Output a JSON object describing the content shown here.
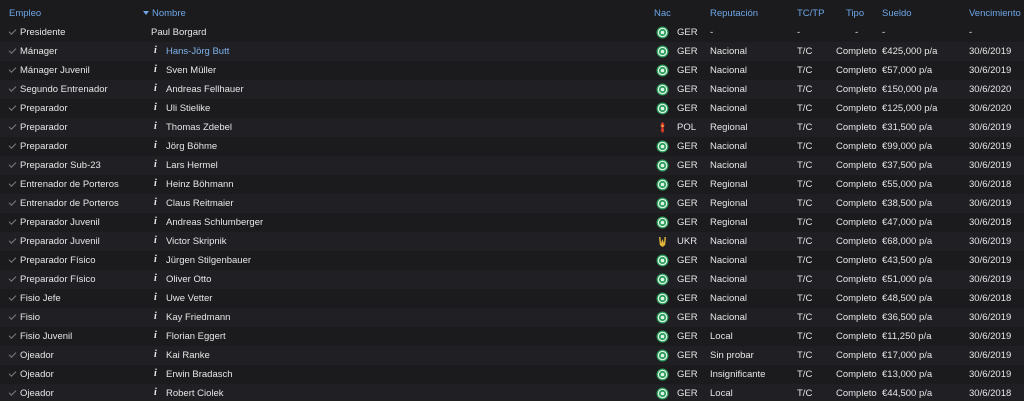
{
  "columns": {
    "empleo": "Empleo",
    "nombre": "Nombre",
    "nac": "Nac",
    "reputacion": "Reputación",
    "tctp": "TC/TP",
    "tipo": "Tipo",
    "sueldo": "Sueldo",
    "vencimiento": "Vencimiento"
  },
  "rows": [
    {
      "empleo": "Presidente",
      "nombre": "Paul Borgard",
      "info": "",
      "nac": "GER",
      "flag": "ger",
      "reputacion": "-",
      "tctp": "-",
      "tipo": "-",
      "sueldo": "-",
      "vencimiento": "-"
    },
    {
      "empleo": "Mánager",
      "nombre": "Hans-Jörg Butt",
      "info": "i",
      "nac": "GER",
      "flag": "ger",
      "reputacion": "Nacional",
      "tctp": "T/C",
      "tipo": "Completo",
      "sueldo": "€425,000 p/a",
      "vencimiento": "30/6/2019"
    },
    {
      "empleo": "Mánager Juvenil",
      "nombre": "Sven Müller",
      "info": "i",
      "nac": "GER",
      "flag": "ger",
      "reputacion": "Nacional",
      "tctp": "T/C",
      "tipo": "Completo",
      "sueldo": "€57,000 p/a",
      "vencimiento": "30/6/2019"
    },
    {
      "empleo": "Segundo Entrenador",
      "nombre": "Andreas Fellhauer",
      "info": "i",
      "nac": "GER",
      "flag": "ger",
      "reputacion": "Nacional",
      "tctp": "T/C",
      "tipo": "Completo",
      "sueldo": "€150,000 p/a",
      "vencimiento": "30/6/2020"
    },
    {
      "empleo": "Preparador",
      "nombre": "Uli Stielike",
      "info": "i",
      "nac": "GER",
      "flag": "ger",
      "reputacion": "Nacional",
      "tctp": "T/C",
      "tipo": "Completo",
      "sueldo": "€125,000 p/a",
      "vencimiento": "30/6/2020"
    },
    {
      "empleo": "Preparador",
      "nombre": "Thomas Zdebel",
      "info": "i",
      "nac": "POL",
      "flag": "pol",
      "reputacion": "Regional",
      "tctp": "T/C",
      "tipo": "Completo",
      "sueldo": "€31,500 p/a",
      "vencimiento": "30/6/2019"
    },
    {
      "empleo": "Preparador",
      "nombre": "Jörg Böhme",
      "info": "i",
      "nac": "GER",
      "flag": "ger",
      "reputacion": "Nacional",
      "tctp": "T/C",
      "tipo": "Completo",
      "sueldo": "€99,000 p/a",
      "vencimiento": "30/6/2019"
    },
    {
      "empleo": "Preparador Sub-23",
      "nombre": "Lars Hermel",
      "info": "i",
      "nac": "GER",
      "flag": "ger",
      "reputacion": "Nacional",
      "tctp": "T/C",
      "tipo": "Completo",
      "sueldo": "€37,500 p/a",
      "vencimiento": "30/6/2019"
    },
    {
      "empleo": "Entrenador de Porteros",
      "nombre": "Heinz Böhmann",
      "info": "i",
      "nac": "GER",
      "flag": "ger",
      "reputacion": "Regional",
      "tctp": "T/C",
      "tipo": "Completo",
      "sueldo": "€55,000 p/a",
      "vencimiento": "30/6/2018"
    },
    {
      "empleo": "Entrenador de Porteros",
      "nombre": "Claus Reitmaier",
      "info": "i",
      "nac": "GER",
      "flag": "ger",
      "reputacion": "Regional",
      "tctp": "T/C",
      "tipo": "Completo",
      "sueldo": "€38,500 p/a",
      "vencimiento": "30/6/2019"
    },
    {
      "empleo": "Preparador Juvenil",
      "nombre": "Andreas Schlumberger",
      "info": "i",
      "nac": "GER",
      "flag": "ger",
      "reputacion": "Regional",
      "tctp": "T/C",
      "tipo": "Completo",
      "sueldo": "€47,000 p/a",
      "vencimiento": "30/6/2018"
    },
    {
      "empleo": "Preparador Juvenil",
      "nombre": "Victor Skripnik",
      "info": "i",
      "nac": "UKR",
      "flag": "ukr",
      "reputacion": "Nacional",
      "tctp": "T/C",
      "tipo": "Completo",
      "sueldo": "€68,000 p/a",
      "vencimiento": "30/6/2019"
    },
    {
      "empleo": "Preparador Físico",
      "nombre": "Jürgen Stilgenbauer",
      "info": "i",
      "nac": "GER",
      "flag": "ger",
      "reputacion": "Nacional",
      "tctp": "T/C",
      "tipo": "Completo",
      "sueldo": "€43,500 p/a",
      "vencimiento": "30/6/2019"
    },
    {
      "empleo": "Preparador Físico",
      "nombre": "Oliver Otto",
      "info": "i",
      "nac": "GER",
      "flag": "ger",
      "reputacion": "Nacional",
      "tctp": "T/C",
      "tipo": "Completo",
      "sueldo": "€51,000 p/a",
      "vencimiento": "30/6/2019"
    },
    {
      "empleo": "Fisio Jefe",
      "nombre": "Uwe Vetter",
      "info": "i",
      "nac": "GER",
      "flag": "ger",
      "reputacion": "Nacional",
      "tctp": "T/C",
      "tipo": "Completo",
      "sueldo": "€48,500 p/a",
      "vencimiento": "30/6/2018"
    },
    {
      "empleo": "Fisio",
      "nombre": "Kay Friedmann",
      "info": "i",
      "nac": "GER",
      "flag": "ger",
      "reputacion": "Nacional",
      "tctp": "T/C",
      "tipo": "Completo",
      "sueldo": "€36,500 p/a",
      "vencimiento": "30/6/2019"
    },
    {
      "empleo": "Fisio Juvenil",
      "nombre": "Florian Eggert",
      "info": "i",
      "nac": "GER",
      "flag": "ger",
      "reputacion": "Local",
      "tctp": "T/C",
      "tipo": "Completo",
      "sueldo": "€11,250 p/a",
      "vencimiento": "30/6/2019"
    },
    {
      "empleo": "Ojeador",
      "nombre": "Kai Ranke",
      "info": "i",
      "nac": "GER",
      "flag": "ger",
      "reputacion": "Sin probar",
      "tctp": "T/C",
      "tipo": "Completo",
      "sueldo": "€17,000 p/a",
      "vencimiento": "30/6/2019"
    },
    {
      "empleo": "Ojeador",
      "nombre": "Erwin Bradasch",
      "info": "i",
      "nac": "GER",
      "flag": "ger",
      "reputacion": "Insignificante",
      "tctp": "T/C",
      "tipo": "Completo",
      "sueldo": "€13,000 p/a",
      "vencimiento": "30/6/2019"
    },
    {
      "empleo": "Ojeador",
      "nombre": "Robert Ciolek",
      "info": "i",
      "nac": "GER",
      "flag": "ger",
      "reputacion": "Local",
      "tctp": "T/C",
      "tipo": "Completo",
      "sueldo": "€44,500 p/a",
      "vencimiento": "30/6/2018"
    }
  ]
}
